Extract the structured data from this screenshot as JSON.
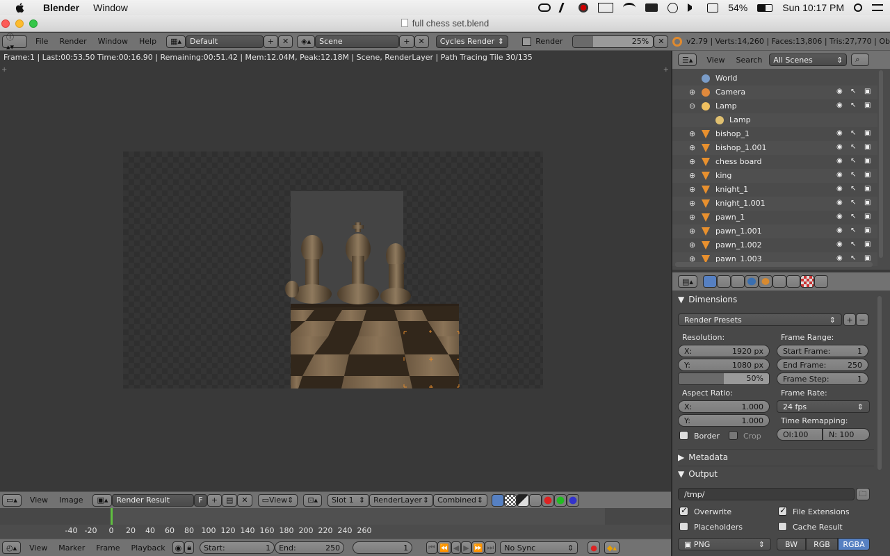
{
  "mac_menubar": {
    "app": "Blender",
    "menu": "Window",
    "battery": "54%",
    "clock": "Sun 10:17 PM"
  },
  "window": {
    "title": "full chess set.blend"
  },
  "info_header": {
    "menus": [
      "File",
      "Render",
      "Window",
      "Help"
    ],
    "layout": "Default",
    "scene": "Scene",
    "engine": "Cycles Render",
    "render_label": "Render",
    "progress": "25%",
    "progress_fraction": 0.25,
    "stats": "v2.79 | Verts:14,260 | Faces:13,806 | Tris:27,770 | Ob"
  },
  "status_line": "Frame:1 | Last:00:53.50 Time:00:16.90 | Remaining:00:51.42 | Mem:12.04M, Peak:12.18M | Scene, RenderLayer | Path Tracing Tile 30/135",
  "image_header": {
    "menus": [
      "View",
      "Image"
    ],
    "image": "Render Result",
    "fake_user": "F",
    "view": "View",
    "slot": "Slot 1",
    "layer": "RenderLayer",
    "pass": "Combined"
  },
  "timeline": {
    "ticks": [
      "-40",
      "-20",
      "0",
      "20",
      "40",
      "60",
      "80",
      "100",
      "120",
      "140",
      "160",
      "180",
      "200",
      "220",
      "240",
      "260"
    ],
    "current_frame": 0
  },
  "timeline_header": {
    "menus": [
      "View",
      "Marker",
      "Frame",
      "Playback"
    ],
    "start_label": "Start:",
    "start": "1",
    "end_label": "End:",
    "end": "250",
    "frame": "1",
    "sync": "No Sync"
  },
  "outliner_header": {
    "menus": [
      "View",
      "Search"
    ],
    "filter": "All Scenes"
  },
  "outliner": [
    {
      "name": "World",
      "type": "world",
      "indent": 1
    },
    {
      "name": "Camera",
      "type": "camera",
      "indent": 1
    },
    {
      "name": "Lamp",
      "type": "lamp",
      "indent": 1
    },
    {
      "name": "Lamp",
      "type": "lamp-data",
      "indent": 2
    },
    {
      "name": "bishop_1",
      "type": "mesh",
      "indent": 1
    },
    {
      "name": "bishop_1.001",
      "type": "mesh",
      "indent": 1
    },
    {
      "name": "chess board",
      "type": "mesh",
      "indent": 1
    },
    {
      "name": "king",
      "type": "mesh",
      "indent": 1
    },
    {
      "name": "knight_1",
      "type": "mesh",
      "indent": 1
    },
    {
      "name": "knight_1.001",
      "type": "mesh",
      "indent": 1
    },
    {
      "name": "pawn_1",
      "type": "mesh",
      "indent": 1
    },
    {
      "name": "pawn_1.001",
      "type": "mesh",
      "indent": 1
    },
    {
      "name": "pawn_1.002",
      "type": "mesh",
      "indent": 1
    },
    {
      "name": "pawn_1.003",
      "type": "mesh",
      "indent": 1
    }
  ],
  "properties": {
    "dimensions": "Dimensions",
    "render_presets": "Render Presets",
    "resolution_label": "Resolution:",
    "res_x_label": "X:",
    "res_x": "1920 px",
    "res_y_label": "Y:",
    "res_y": "1080 px",
    "res_pct": "50%",
    "frame_range_label": "Frame Range:",
    "start_frame_label": "Start Frame:",
    "start_frame": "1",
    "end_frame_label": "End Frame:",
    "end_frame": "250",
    "frame_step_label": "Frame Step:",
    "frame_step": "1",
    "aspect_label": "Aspect Ratio:",
    "asp_x_label": "X:",
    "asp_x": "1.000",
    "asp_y_label": "Y:",
    "asp_y": "1.000",
    "frame_rate_label": "Frame Rate:",
    "fps": "24 fps",
    "time_remap_label": "Time Remapping:",
    "old": "Ol:100",
    "new": "N: 100",
    "border": "Border",
    "crop": "Crop",
    "metadata": "Metadata",
    "output": "Output",
    "output_path": "/tmp/",
    "overwrite": "Overwrite",
    "file_extensions": "File Extensions",
    "placeholders": "Placeholders",
    "cache_result": "Cache Result",
    "format": "PNG",
    "bw": "BW",
    "rgb": "RGB",
    "rgba": "RGBA"
  },
  "colors": {
    "accent": "#5680c2",
    "playhead": "#60c040",
    "orange": "#e08a2e"
  }
}
